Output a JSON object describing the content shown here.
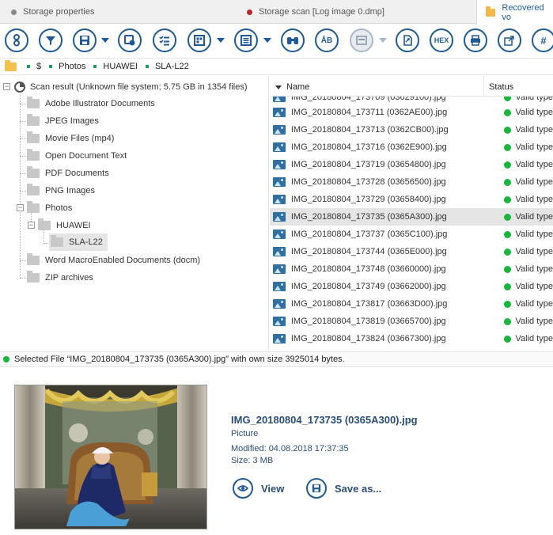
{
  "tabs": [
    {
      "label": "Storage properties",
      "dot_color": "#8a8a8a"
    },
    {
      "label": "Storage scan [Log image 0.dmp]",
      "dot_color": "#b5282e"
    },
    {
      "label": "Recovered vo",
      "active": true
    }
  ],
  "toolbar": {
    "buttons": [
      {
        "name": "info-icon",
        "glyph": "i"
      },
      {
        "name": "filter-icon",
        "glyph": "▼"
      },
      {
        "name": "save-icon",
        "glyph": "▣"
      },
      {
        "name": "save-files-icon",
        "glyph": "◫"
      },
      {
        "name": "checklist-icon",
        "glyph": "☰"
      },
      {
        "name": "view-mode-icon",
        "glyph": "▦"
      },
      {
        "name": "list-view-icon",
        "glyph": "≡"
      },
      {
        "name": "find-icon",
        "glyph": "⚲"
      },
      {
        "name": "find-text-icon",
        "glyph": "ÅB"
      },
      {
        "name": "preview-icon",
        "glyph": "▭"
      },
      {
        "name": "export-icon",
        "glyph": "⎗"
      },
      {
        "name": "hex-icon",
        "glyph": "HEX"
      },
      {
        "name": "print-icon",
        "glyph": "⎙"
      },
      {
        "name": "open-icon",
        "glyph": "⇱"
      },
      {
        "name": "hash-icon",
        "glyph": "#"
      }
    ]
  },
  "breadcrumb": [
    "$",
    "Photos",
    "HUAWEI",
    "SLA-L22"
  ],
  "tree": {
    "root": "Scan result (Unknown file system; 5.75 GB in 1354 files)",
    "items": [
      "Adobe Illustrator Documents",
      "JPEG Images",
      "Movie Files (mp4)",
      "Open Document Text",
      "PDF Documents",
      "PNG Images",
      "Photos",
      "Word MacroEnabled Documents (docm)",
      "ZIP archives"
    ],
    "photos_child": "HUAWEI",
    "huawei_child": "SLA-L22"
  },
  "list": {
    "col_name": "Name",
    "col_status": "Status",
    "partial_top_row": {
      "name": "IMG_20180804_173709 (03629100).jpg",
      "status": "Valid type"
    },
    "rows": [
      {
        "name": "IMG_20180804_173711 (0362AE00).jpg",
        "status": "Valid type"
      },
      {
        "name": "IMG_20180804_173713 (0362CB00).jpg",
        "status": "Valid type"
      },
      {
        "name": "IMG_20180804_173716 (0362E900).jpg",
        "status": "Valid type"
      },
      {
        "name": "IMG_20180804_173719 (03654800).jpg",
        "status": "Valid type"
      },
      {
        "name": "IMG_20180804_173728 (03656500).jpg",
        "status": "Valid type"
      },
      {
        "name": "IMG_20180804_173729 (03658400).jpg",
        "status": "Valid type"
      },
      {
        "name": "IMG_20180804_173735 (0365A300).jpg",
        "status": "Valid type",
        "selected": true
      },
      {
        "name": "IMG_20180804_173737 (0365C100).jpg",
        "status": "Valid type"
      },
      {
        "name": "IMG_20180804_173744 (0365E000).jpg",
        "status": "Valid type"
      },
      {
        "name": "IMG_20180804_173748 (03660000).jpg",
        "status": "Valid type"
      },
      {
        "name": "IMG_20180804_173749 (03662000).jpg",
        "status": "Valid type"
      },
      {
        "name": "IMG_20180804_173817 (03663D00).jpg",
        "status": "Valid type"
      },
      {
        "name": "IMG_20180804_173819 (03665700).jpg",
        "status": "Valid type"
      },
      {
        "name": "IMG_20180804_173824 (03667300).jpg",
        "status": "Valid type"
      }
    ]
  },
  "statusbar": {
    "text": "Selected File “IMG_20180804_173735 (0365A300).jpg” with own size 3925014 bytes."
  },
  "preview": {
    "title": "IMG_20180804_173735 (0365A300).jpg",
    "type": "Picture",
    "modified": "Modified: 04.08.2018 17:37:35",
    "size": "Size: 3 MB",
    "view_label": "View",
    "save_label": "Save as..."
  },
  "colors": {
    "accent": "#1f5a96",
    "valid_green": "#19b53c",
    "link_text": "#2a4d78"
  }
}
